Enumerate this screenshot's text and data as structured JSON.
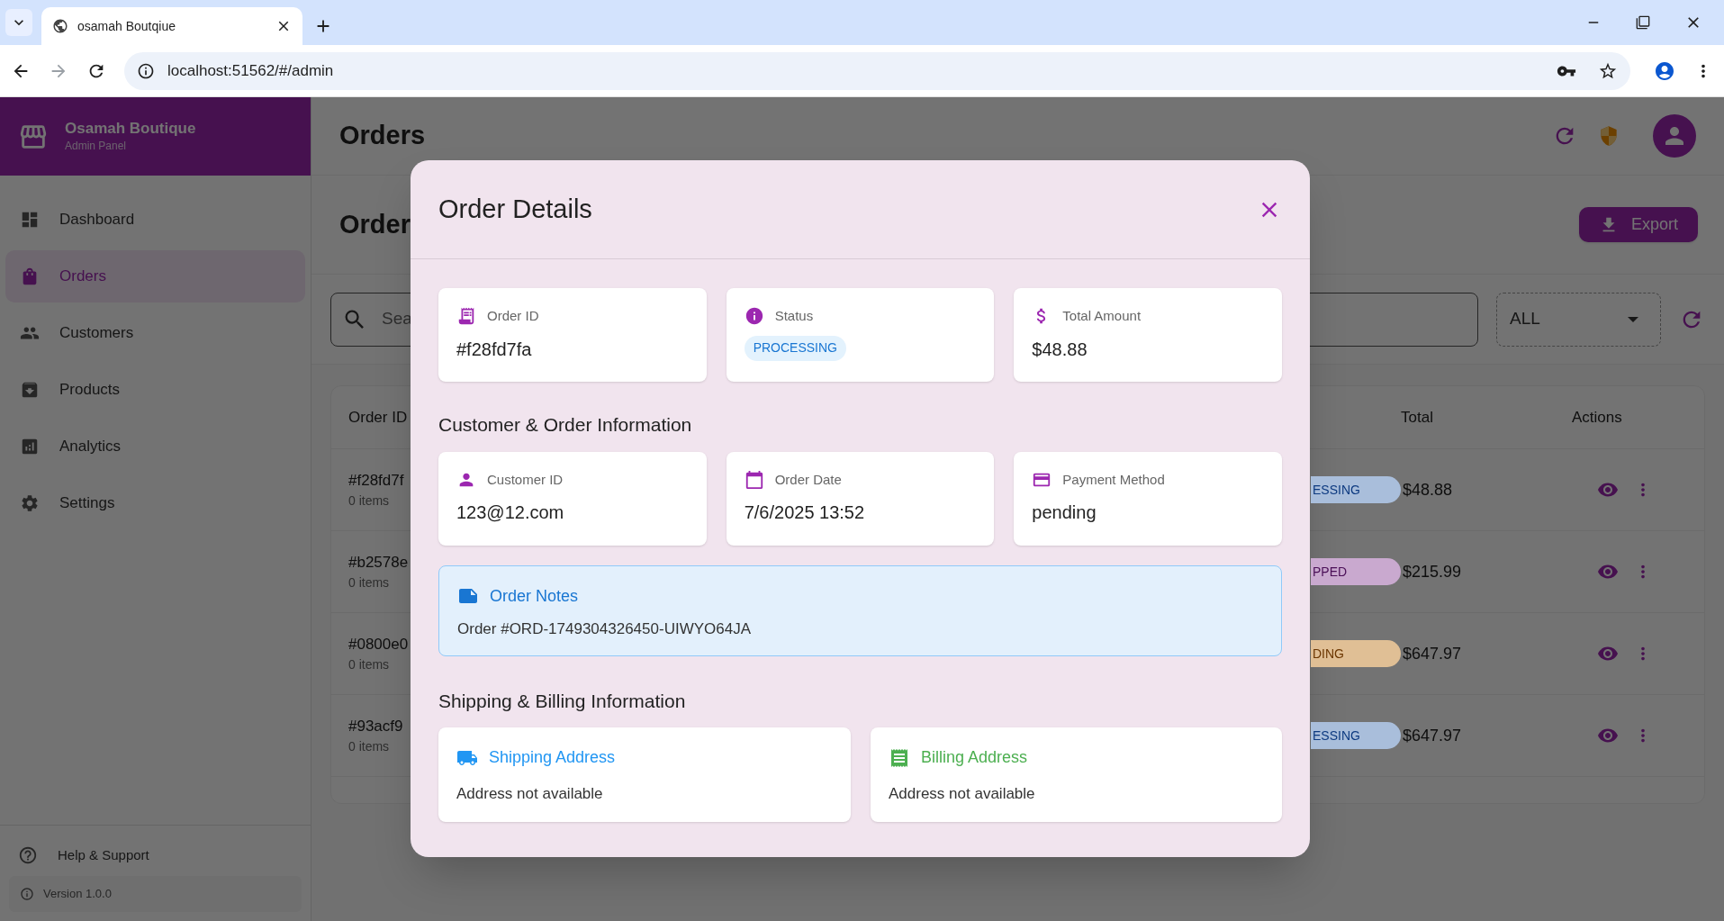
{
  "browser": {
    "tab_title": "osamah Boutqiue",
    "url": "localhost:51562/#/admin"
  },
  "sidebar": {
    "brand": "Osamah Boutique",
    "subtitle": "Admin Panel",
    "items": [
      {
        "label": "Dashboard",
        "selected": false
      },
      {
        "label": "Orders",
        "selected": true
      },
      {
        "label": "Customers",
        "selected": false
      },
      {
        "label": "Products",
        "selected": false
      },
      {
        "label": "Analytics",
        "selected": false
      },
      {
        "label": "Settings",
        "selected": false
      }
    ],
    "help": "Help & Support",
    "version": "Version 1.0.0"
  },
  "header": {
    "title": "Orders"
  },
  "page": {
    "title": "Order",
    "export": "Export",
    "search_placeholder": "Sea",
    "filter": "ALL"
  },
  "table": {
    "columns": [
      "Order ID",
      "Total",
      "Actions"
    ],
    "rows": [
      {
        "order_id": "#f28fd7f",
        "items": "0 items",
        "status": "ESSING",
        "color": "#a9bedb",
        "total": "$48.88"
      },
      {
        "order_id": "#b2578e",
        "items": "0 items",
        "status": "PPED",
        "color": "#c9a9cf",
        "total": "$215.99"
      },
      {
        "order_id": "#0800e0",
        "items": "0 items",
        "status": "DING",
        "color": "#e0bf95",
        "total": "$647.97"
      },
      {
        "order_id": "#93acf9",
        "items": "0 items",
        "status": "ESSING",
        "color": "#a9bedb",
        "total": "$647.97"
      }
    ]
  },
  "modal": {
    "title": "Order Details",
    "summary": [
      {
        "label": "Order ID",
        "kind": "text",
        "value": "#f28fd7fa"
      },
      {
        "label": "Status",
        "kind": "badge",
        "value": "PROCESSING"
      },
      {
        "label": "Total Amount",
        "kind": "text",
        "value": "$48.88"
      }
    ],
    "customer_heading": "Customer & Order Information",
    "customer": [
      {
        "label": "Customer ID",
        "value": "123@12.com"
      },
      {
        "label": "Order Date",
        "value": "7/6/2025 13:52"
      },
      {
        "label": "Payment Method",
        "value": "pending"
      }
    ],
    "notes": {
      "title": "Order Notes",
      "text": "Order #ORD-1749304326450-UIWYO64JA"
    },
    "address_heading": "Shipping & Billing Information",
    "addresses": [
      {
        "title": "Shipping Address",
        "text": "Address not available"
      },
      {
        "title": "Billing Address",
        "text": "Address not available"
      }
    ]
  }
}
